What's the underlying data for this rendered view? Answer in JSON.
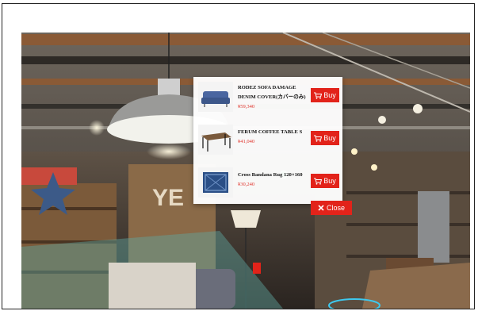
{
  "products": [
    {
      "name_line1": "RODEZ SOFA DAMAGE",
      "name_line2": "DENIM COVER(カバーのみ)",
      "price": "¥59,340",
      "buy_label": "Buy",
      "thumb_icon": "sofa-icon"
    },
    {
      "name_line1": "FERUM COFFEE TABLE S",
      "name_line2": "",
      "price": "¥41,040",
      "buy_label": "Buy",
      "thumb_icon": "coffee-table-icon"
    },
    {
      "name_line1": "Cross Bandana Rug 120×160",
      "name_line2": "",
      "price": "¥30,240",
      "buy_label": "Buy",
      "thumb_icon": "rug-icon"
    }
  ],
  "close_label": "Close",
  "icons": {
    "cart": "cart-icon",
    "close": "close-x-icon",
    "hotspot": "hotspot-dot"
  },
  "colors": {
    "accent": "#e2231a",
    "price": "#e0322a",
    "hotspot": "#2fb24a"
  }
}
